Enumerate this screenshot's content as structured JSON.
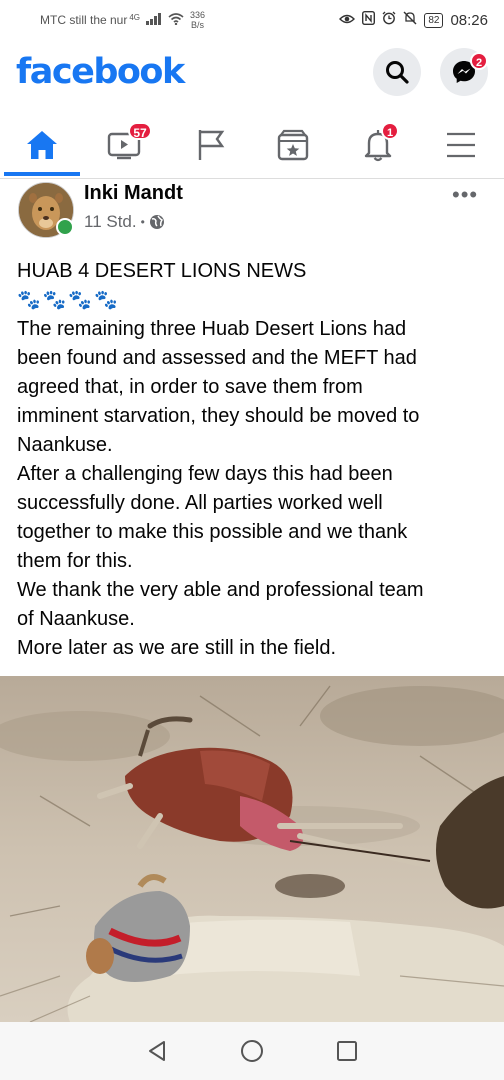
{
  "status_bar": {
    "carrier": "MTC still the nur",
    "network": "4G",
    "net_speed_value": "336",
    "net_speed_unit": "B/s",
    "battery": "82",
    "time": "08:26"
  },
  "header": {
    "logo": "facebook",
    "messenger_badge": "2"
  },
  "tabs": {
    "watch_badge": "57",
    "notifications_badge": "1"
  },
  "post": {
    "author": "Inki Mandt",
    "time": "11 Std.",
    "separator": "•",
    "more": "•••",
    "lines": [
      "HUAB 4 DESERT LIONS NEWS",
      "🐾🐾🐾🐾",
      "The remaining three Huab Desert Lions had",
      "been found and assessed and the MEFT had",
      "agreed that, in order to save them from",
      "imminent starvation, they should be moved to",
      "Naankuse.",
      "After a challenging few days this had been",
      "successfully done. All parties worked well",
      "together to make this possible and we thank",
      "them for this.",
      "We thank the very able and professional team",
      "of Naankuse.",
      "More later as we are still in the field."
    ]
  },
  "colors": {
    "brand": "#1877f2",
    "badge": "#e41e3f",
    "online": "#31a24c"
  }
}
